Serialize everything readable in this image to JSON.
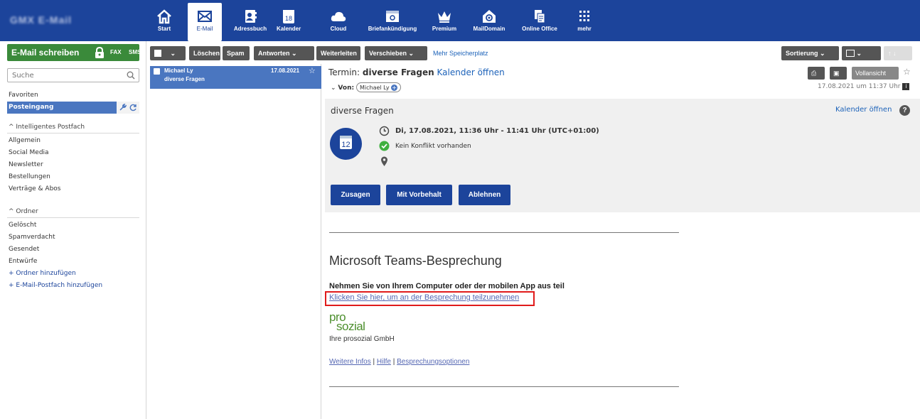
{
  "app": {
    "logo_text": "GMX E-Mail"
  },
  "nav": [
    {
      "label": "Start",
      "icon": "home-icon"
    },
    {
      "label": "E-Mail",
      "icon": "mail-icon"
    },
    {
      "label": "Adressbuch",
      "icon": "addressbook-icon"
    },
    {
      "label": "Kalender",
      "icon": "calendar-icon",
      "day": "18"
    },
    {
      "label": "Cloud",
      "icon": "cloud-icon"
    },
    {
      "label": "Briefankündigung",
      "icon": "letter-icon"
    },
    {
      "label": "Premium",
      "icon": "crown-icon"
    },
    {
      "label": "MailDomain",
      "icon": "maildomain-icon"
    },
    {
      "label": "Online Office",
      "icon": "office-icon"
    },
    {
      "label": "mehr",
      "icon": "grid-icon"
    }
  ],
  "compose": {
    "label": "E-Mail schreiben",
    "fax": "FAX",
    "sms": "SMS"
  },
  "search": {
    "placeholder": "Suche"
  },
  "folders": {
    "favoriten": "Favoriten",
    "posteingang": "Posteingang",
    "smart_head": "Intelligentes Postfach",
    "smart": [
      "Allgemein",
      "Social Media",
      "Newsletter",
      "Bestellungen",
      "Verträge & Abos"
    ],
    "ordner_head": "Ordner",
    "ordner": [
      "Gelöscht",
      "Spamverdacht",
      "Gesendet",
      "Entwürfe"
    ],
    "add_folder": "Ordner hinzufügen",
    "add_mailbox": "E-Mail-Postfach hinzufügen"
  },
  "toolbar": {
    "delete": "Löschen",
    "spam": "Spam",
    "reply": "Antworten",
    "forward": "Weiterleiten",
    "move": "Verschieben",
    "more_storage": "Mehr Speicherplatz",
    "sort": "Sortierung"
  },
  "message_list": [
    {
      "sender": "Michael Ly",
      "subject": "diverse Fragen",
      "date": "17.08.2021"
    }
  ],
  "reading": {
    "subject_prefix": "Termin:",
    "subject": "diverse Fragen",
    "open_calendar": "Kalender öffnen",
    "from_label": "Von:",
    "from_name": "Michael Ly",
    "received": "17.08.2021 um 11:37 Uhr",
    "full_view": "Vollansicht"
  },
  "invite": {
    "title": "diverse Fragen",
    "open_calendar": "Kalender öffnen",
    "calendar_day": "12",
    "time": "Di, 17.08.2021, 11:36 Uhr - 11:41 Uhr (UTC+01:00)",
    "conflict": "Kein Konflikt vorhanden",
    "accept": "Zusagen",
    "tentative": "Mit Vorbehalt",
    "decline": "Ablehnen"
  },
  "body": {
    "heading": "Microsoft Teams-Besprechung",
    "instruction": "Nehmen Sie von Ihrem Computer oder der mobilen App aus teil",
    "join_link": "Klicken Sie hier, um an der Besprechung teilzunehmen",
    "logo_pro": "pro",
    "logo_sozial": "sozial",
    "company": "Ihre prosozial GmbH",
    "more_info": "Weitere Infos",
    "help": "Hilfe",
    "options": "Besprechungsoptionen",
    "sep": "|"
  },
  "colors": {
    "brand": "#1c449b",
    "compose": "#3a8a3a",
    "selected": "#4a76c0",
    "highlight": "#e01b1b"
  }
}
